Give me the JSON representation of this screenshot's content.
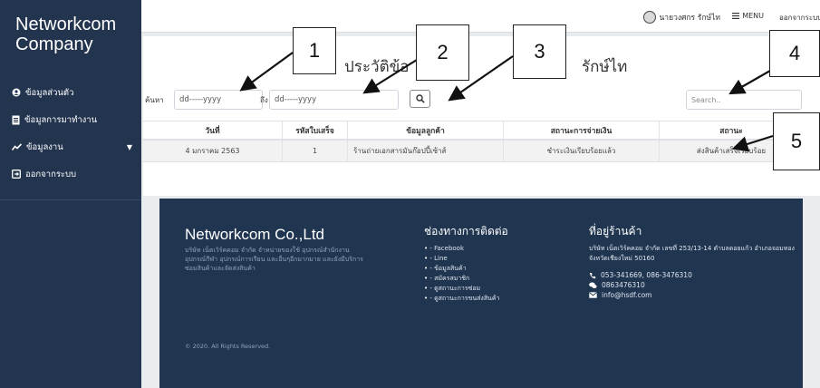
{
  "sidebar": {
    "brand_line1": "Networkcom",
    "brand_line2": "Company",
    "items": [
      {
        "label": "ข้อมูลส่วนตัว",
        "icon": "user-circle-icon"
      },
      {
        "label": "ข้อมูลการมาทำงาน",
        "icon": "document-icon"
      },
      {
        "label": "ข้อมูลงาน",
        "icon": "chart-line-icon",
        "has_dropdown": true
      },
      {
        "label": "ออกจากระบบ",
        "icon": "sign-out-icon"
      }
    ]
  },
  "topbar": {
    "user_name": "นายวงศกร รักษ์ไท",
    "menu_label": "MENU",
    "logout_label": "ออกจากระบบ"
  },
  "page": {
    "title_part1": "ประวัติข้อ",
    "title_part2": "รักษ์ไท"
  },
  "filter": {
    "search_label": "ค้นหา",
    "to_label": "ถึง",
    "date_from_placeholder": "dd-----yyyy",
    "date_to_placeholder": "dd-----yyyy",
    "search_placeholder": "Search.."
  },
  "table": {
    "headers": [
      "วันที่",
      "รหัสใบเสร็จ",
      "ข้อมูลลูกค้า",
      "สถานะการจ่ายเงิน",
      "สถานะ"
    ],
    "rows": [
      [
        "4 มกราคม 2563",
        "1",
        "ร้านถ่ายเอกสารมันก๊อปปี้เซ้าส์",
        "ชำระเงินเรียบร้อยแล้ว",
        "ส่งสินค้าเสร็จเรียบร้อย"
      ]
    ]
  },
  "footer": {
    "brand": "Networkcom Co.,Ltd",
    "description": "บริษัท เน็ตเวิร์คคอม จำกัด จำหน่ายของใช้ อุปกรณ์สำนักงาน อุปกรณ์กีฬา อุปกรณ์การเรียน และอื่นๆอีกมากมาย และยังมีบริการซ่อมสินค้าและจัดส่งสินค้า",
    "contact_heading": "ช่องทางการติดต่อ",
    "contact_links": [
      "- Facebook",
      "- Line",
      "- ข้อมูลสินค้า",
      "- สมัครสมาชิก",
      "- ดูสถานะการซ่อม",
      "- ดูสถานะการขนส่งสินค้า"
    ],
    "address_heading": "ที่อยู่ร้านค้า",
    "address": "บริษัท เน็ตเวิร์คคอม จำกัด เลขที่ 253/13-14 ตำบลดอยแก้ว อำเภอจอมทอง จังหวัดเชียงใหม่ 50160",
    "phone": "053-341669, 086-3476310",
    "mobile": "0863476310",
    "email": "info@hsdf.com",
    "copyright": "© 2020. All Rights Reserved."
  },
  "callouts": [
    "1",
    "2",
    "3",
    "4",
    "5"
  ]
}
